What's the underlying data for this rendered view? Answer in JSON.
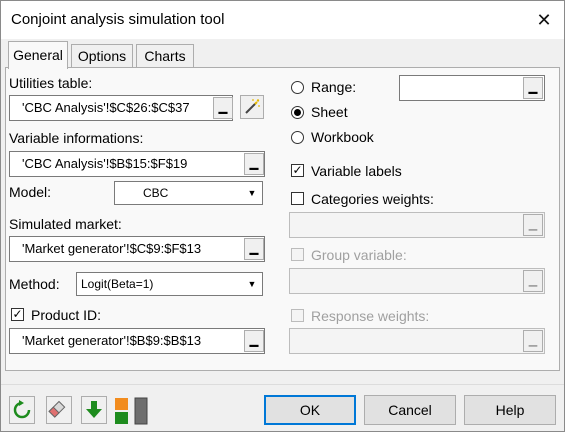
{
  "window": {
    "title": "Conjoint analysis simulation tool",
    "close_glyph": "✕"
  },
  "tabs": [
    {
      "label": "General",
      "active": true
    },
    {
      "label": "Options",
      "active": false
    },
    {
      "label": "Charts",
      "active": false
    }
  ],
  "general": {
    "utilities_label": "Utilities table:",
    "utilities_value": "'CBC Analysis'!$C$26:$C$37",
    "variable_info_label": "Variable informations:",
    "variable_info_value": "'CBC Analysis'!$B$15:$F$19",
    "model_label": "Model:",
    "model_value": "CBC",
    "simulated_market_label": "Simulated market:",
    "simulated_market_value": "'Market generator'!$C$9:$F$13",
    "method_label": "Method:",
    "method_value": "Logit(Beta=1)",
    "product_id_label": "Product ID:",
    "product_id_checked": true,
    "product_id_value": "'Market generator'!$B$9:$B$13",
    "output_options": [
      {
        "label": "Range:",
        "selected": false
      },
      {
        "label": "Sheet",
        "selected": true
      },
      {
        "label": "Workbook",
        "selected": false
      }
    ],
    "range_value": "",
    "variable_labels_label": "Variable labels",
    "variable_labels_checked": true,
    "categories_weights_label": "Categories weights:",
    "categories_weights_checked": false,
    "categories_weights_value": "",
    "group_variable_label": "Group variable:",
    "group_variable_enabled": false,
    "group_variable_value": "",
    "response_weights_label": "Response weights:",
    "response_weights_enabled": false,
    "response_weights_value": ""
  },
  "footer": {
    "ok_label": "OK",
    "cancel_label": "Cancel",
    "help_label": "Help",
    "icons": [
      "reset-icon",
      "eraser-icon",
      "down-arrow-icon",
      "layout-icon"
    ]
  },
  "colors": {
    "accent": "#0078d7",
    "green": "#1e8c1e",
    "orange": "#f28c1e",
    "wand_yellow": "#e6b800"
  }
}
